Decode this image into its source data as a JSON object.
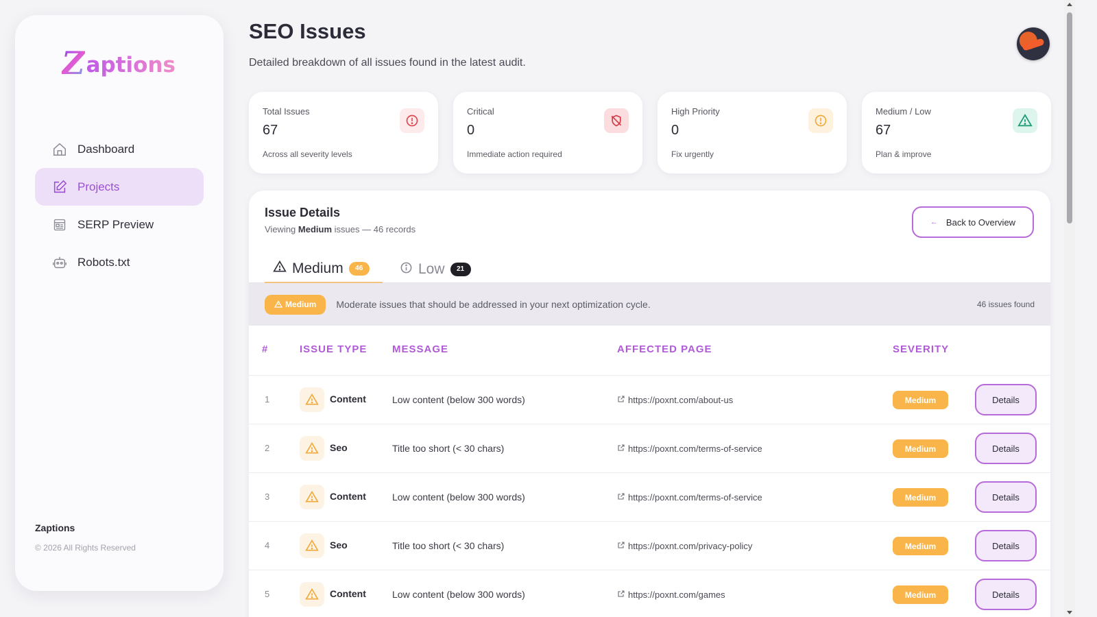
{
  "sidebar": {
    "logo_z": "Z",
    "logo_rest": "aptions",
    "items": [
      {
        "label": "Dashboard",
        "icon": "home-icon"
      },
      {
        "label": "Projects",
        "icon": "edit-icon"
      },
      {
        "label": "SERP Preview",
        "icon": "preview-icon"
      },
      {
        "label": "Robots.txt",
        "icon": "robot-icon"
      }
    ],
    "active_index": 1,
    "footer_brand": "Zaptions",
    "footer_copy": "© 2026 All Rights Reserved"
  },
  "header": {
    "title": "SEO Issues",
    "subtitle": "Detailed breakdown of all issues found in the latest audit."
  },
  "stats": [
    {
      "label": "Total Issues",
      "value": "67",
      "desc": "Across all severity levels",
      "icon": "alert-circle-icon",
      "color": "#e0454f",
      "bg": "#fdeaea"
    },
    {
      "label": "Critical",
      "value": "0",
      "desc": "Immediate action required",
      "icon": "shield-off-icon",
      "color": "#d23a44",
      "bg": "#fbdde0"
    },
    {
      "label": "High Priority",
      "value": "0",
      "desc": "Fix urgently",
      "icon": "alert-circle-icon",
      "color": "#f0a93a",
      "bg": "#fef2df"
    },
    {
      "label": "Medium / Low",
      "value": "67",
      "desc": "Plan & improve",
      "icon": "warning-triangle-icon",
      "color": "#1f9d78",
      "bg": "#ddf5ec"
    }
  ],
  "panel": {
    "title": "Issue Details",
    "sub_prefix": "Viewing ",
    "sub_bold": "Medium",
    "sub_suffix": " issues — 46 records",
    "back_label": "Back to Overview",
    "tabs": [
      {
        "label": "Medium",
        "count": "46"
      },
      {
        "label": "Low",
        "count": "21"
      }
    ],
    "band_pill": "Medium",
    "band_text": "Moderate issues that should be addressed in your next optimization cycle.",
    "band_count": "46 issues found",
    "columns": [
      "#",
      "ISSUE TYPE",
      "MESSAGE",
      "AFFECTED PAGE",
      "SEVERITY"
    ],
    "rows": [
      {
        "num": "1",
        "type": "Content",
        "message": "Low content (below 300 words)",
        "page": "https://poxnt.com/about-us",
        "severity": "Medium",
        "action": "Details"
      },
      {
        "num": "2",
        "type": "Seo",
        "message": "Title too short (< 30 chars)",
        "page": "https://poxnt.com/terms-of-service",
        "severity": "Medium",
        "action": "Details"
      },
      {
        "num": "3",
        "type": "Content",
        "message": "Low content (below 300 words)",
        "page": "https://poxnt.com/terms-of-service",
        "severity": "Medium",
        "action": "Details"
      },
      {
        "num": "4",
        "type": "Seo",
        "message": "Title too short (< 30 chars)",
        "page": "https://poxnt.com/privacy-policy",
        "severity": "Medium",
        "action": "Details"
      },
      {
        "num": "5",
        "type": "Content",
        "message": "Low content (below 300 words)",
        "page": "https://poxnt.com/games",
        "severity": "Medium",
        "action": "Details"
      }
    ]
  },
  "colors": {
    "accent": "#b05ad8",
    "medium": "#f9b54a",
    "active_nav_bg": "#eedff8"
  }
}
